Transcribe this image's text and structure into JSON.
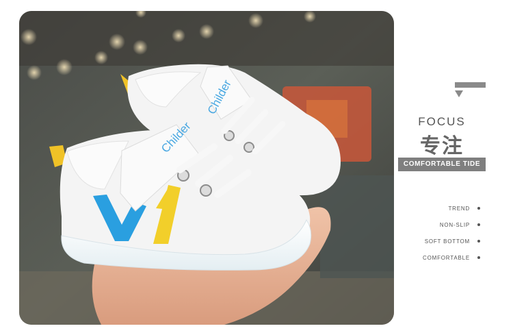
{
  "product_photo": {
    "shoe_brand_text": "Childer",
    "colors": {
      "blue_stripe": "#2a9fe0",
      "yellow_stripe": "#f2cf2a",
      "heel_tab": "#f0c227",
      "shoe_body": "#f4f4f4"
    }
  },
  "side_panel": {
    "heading": "FOCUS",
    "chinese_heading": "专注",
    "banner": "COMFORTABLE TIDE",
    "features": [
      {
        "label": "TREND"
      },
      {
        "label": "NON-SLIP"
      },
      {
        "label": "SOFT BOTTOM"
      },
      {
        "label": "COMFORTABLE"
      }
    ],
    "accent_color": "#7f7f7f"
  }
}
